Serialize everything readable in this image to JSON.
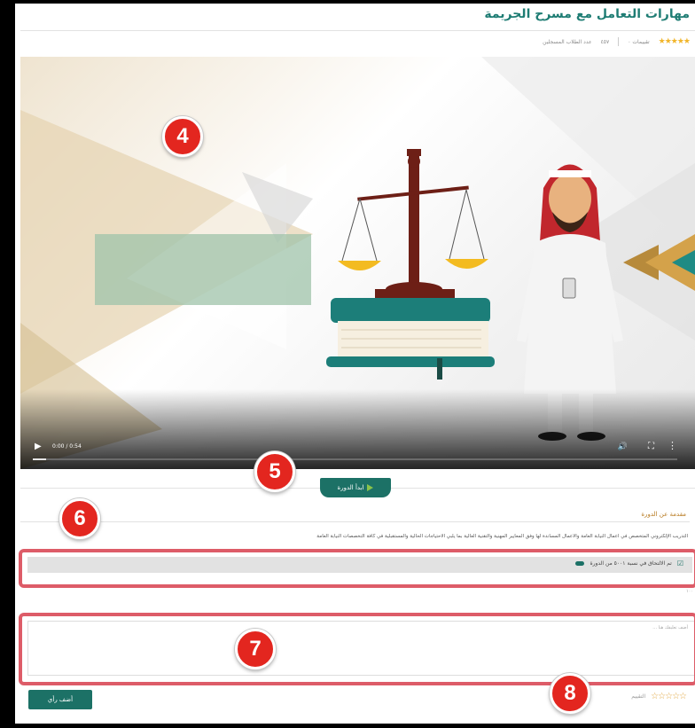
{
  "course": {
    "title": "مهارات التعامل مع مسرح الجريمة",
    "stars": "★★★★★",
    "rating_label": "تقييمات ٠",
    "enrolled_count": "٤٥٧",
    "enrolled_label": "عدد الطلاب المسجلين"
  },
  "video": {
    "time": "0:00 / 0:54",
    "progress_fraction": 0.02,
    "play_icon": "▶",
    "volume_icon": "🔊",
    "fullscreen_icon": "⛶",
    "more_icon": "⋮"
  },
  "start_button": {
    "label": "ابدأ الدورة"
  },
  "about": {
    "heading": "مقدمة عن الدورة",
    "text": "التدريب الإلكتروني المتخصص في أعمال النيابة العامة والأعمال المساندة لها وفق المعايير المهنية والتقنية العالية بما يلبي الاحتياجات الحالية والمستقبلية في كافة التخصصات النيابة العامة"
  },
  "enrollment": {
    "check_icon": "☑",
    "text": "تم الالتحاق في نسبة ٥٠٠١ من الدورة",
    "small": "١٠٠"
  },
  "comment": {
    "placeholder": "أضف تعليقك هنا ..."
  },
  "submit": {
    "label": "أضف رأي"
  },
  "rating": {
    "stars": "☆☆☆☆☆",
    "label": "التقييم"
  },
  "badges": [
    "4",
    "5",
    "6",
    "7",
    "8"
  ],
  "colors": {
    "accent": "#1c7166",
    "badge": "#e3261f",
    "highlight": "#dd5c68",
    "star": "#f1b52a"
  }
}
